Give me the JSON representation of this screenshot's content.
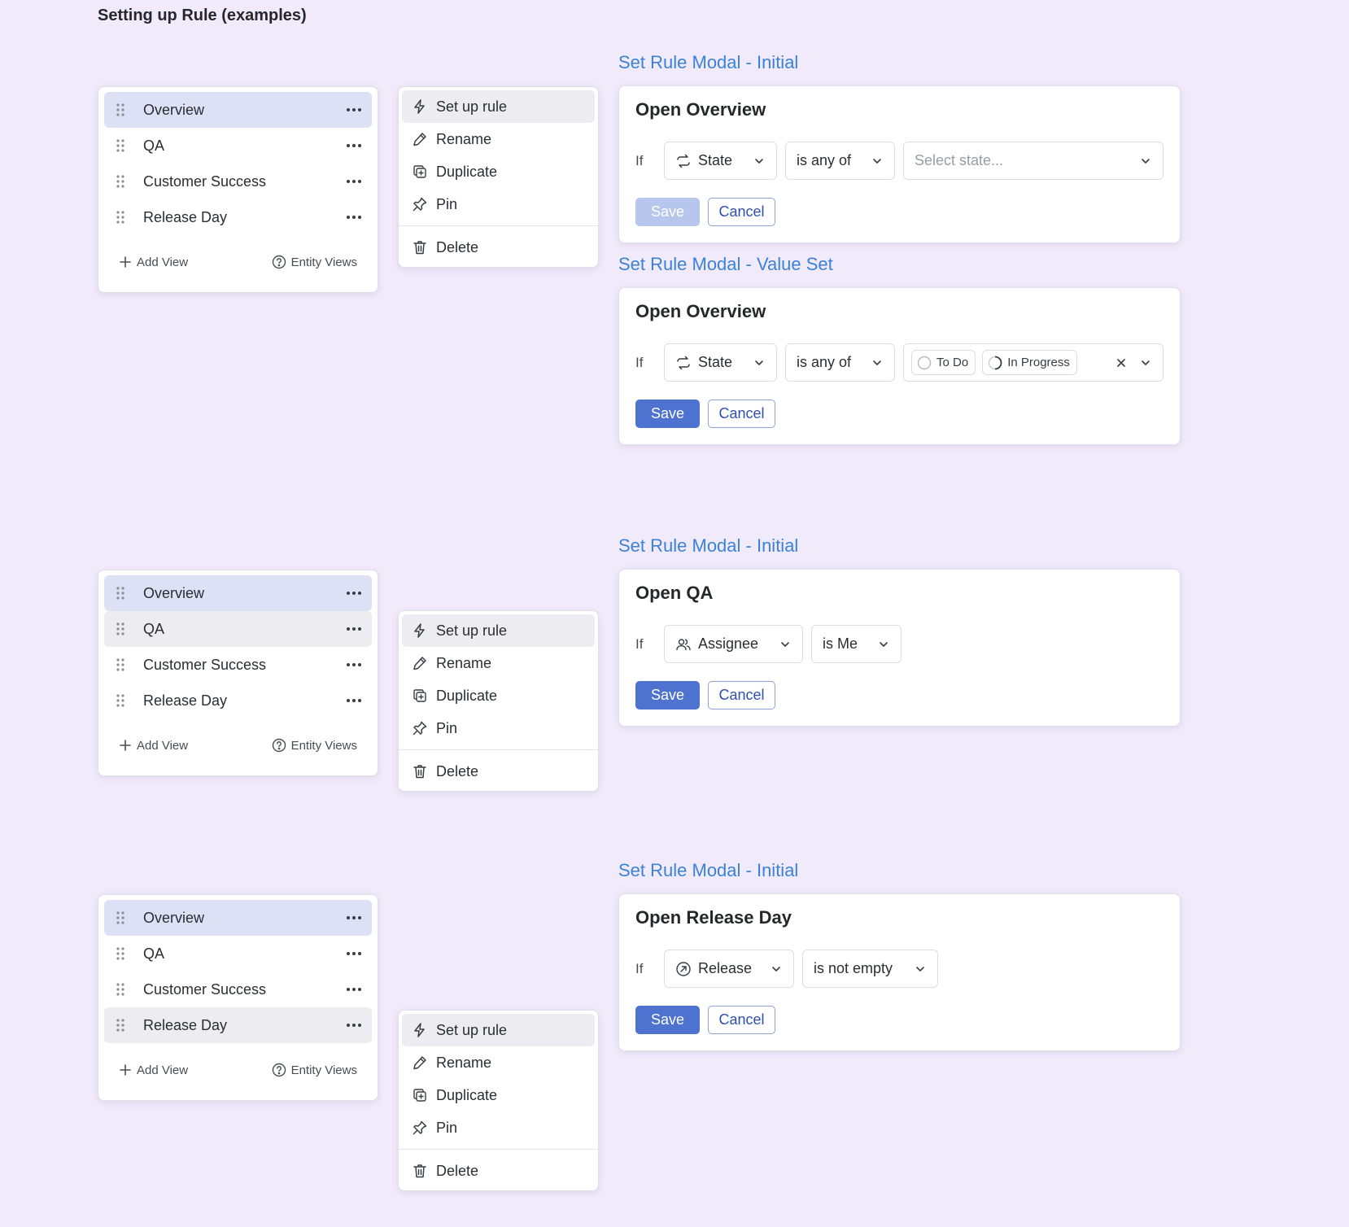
{
  "page_title": "Setting up Rule (examples)",
  "views": [
    "Overview",
    "QA",
    "Customer Success",
    "Release Day"
  ],
  "footer": {
    "add_view": "Add View",
    "entity_views": "Entity Views"
  },
  "menu": {
    "setup": "Set up rule",
    "rename": "Rename",
    "duplicate": "Duplicate",
    "pin": "Pin",
    "delete": "Delete"
  },
  "colors": {
    "background": "#f0eafb",
    "caption": "#3b82d8",
    "primary": "#4e72cf",
    "active_row": "#dde1f6",
    "hover_row": "#ececf1"
  },
  "examples": [
    {
      "modals": [
        {
          "caption": "Set Rule Modal - Initial",
          "title": "Open Overview",
          "if_label": "If",
          "field": {
            "label": "State",
            "icon": "state-cycle-icon"
          },
          "operator": "is any of",
          "value_placeholder": "Select state...",
          "save": "Save",
          "save_disabled": true,
          "cancel": "Cancel"
        },
        {
          "caption": "Set Rule Modal - Value Set",
          "title": "Open Overview",
          "if_label": "If",
          "field": {
            "label": "State",
            "icon": "state-cycle-icon"
          },
          "operator": "is any of",
          "chips": [
            {
              "label": "To Do",
              "icon": "todo-circle-icon"
            },
            {
              "label": "In Progress",
              "icon": "in-progress-circle-icon"
            }
          ],
          "save": "Save",
          "save_disabled": false,
          "cancel": "Cancel"
        }
      ]
    },
    {
      "modals": [
        {
          "caption": "Set Rule Modal - Initial",
          "title": "Open QA",
          "if_label": "If",
          "field": {
            "label": "Assignee",
            "icon": "users-icon"
          },
          "operator": "is Me",
          "save": "Save",
          "save_disabled": false,
          "cancel": "Cancel"
        }
      ]
    },
    {
      "modals": [
        {
          "caption": "Set Rule Modal - Initial",
          "title": "Open Release Day",
          "if_label": "If",
          "field": {
            "label": "Release",
            "icon": "release-icon"
          },
          "operator": "is not empty",
          "save": "Save",
          "save_disabled": false,
          "cancel": "Cancel"
        }
      ]
    }
  ]
}
